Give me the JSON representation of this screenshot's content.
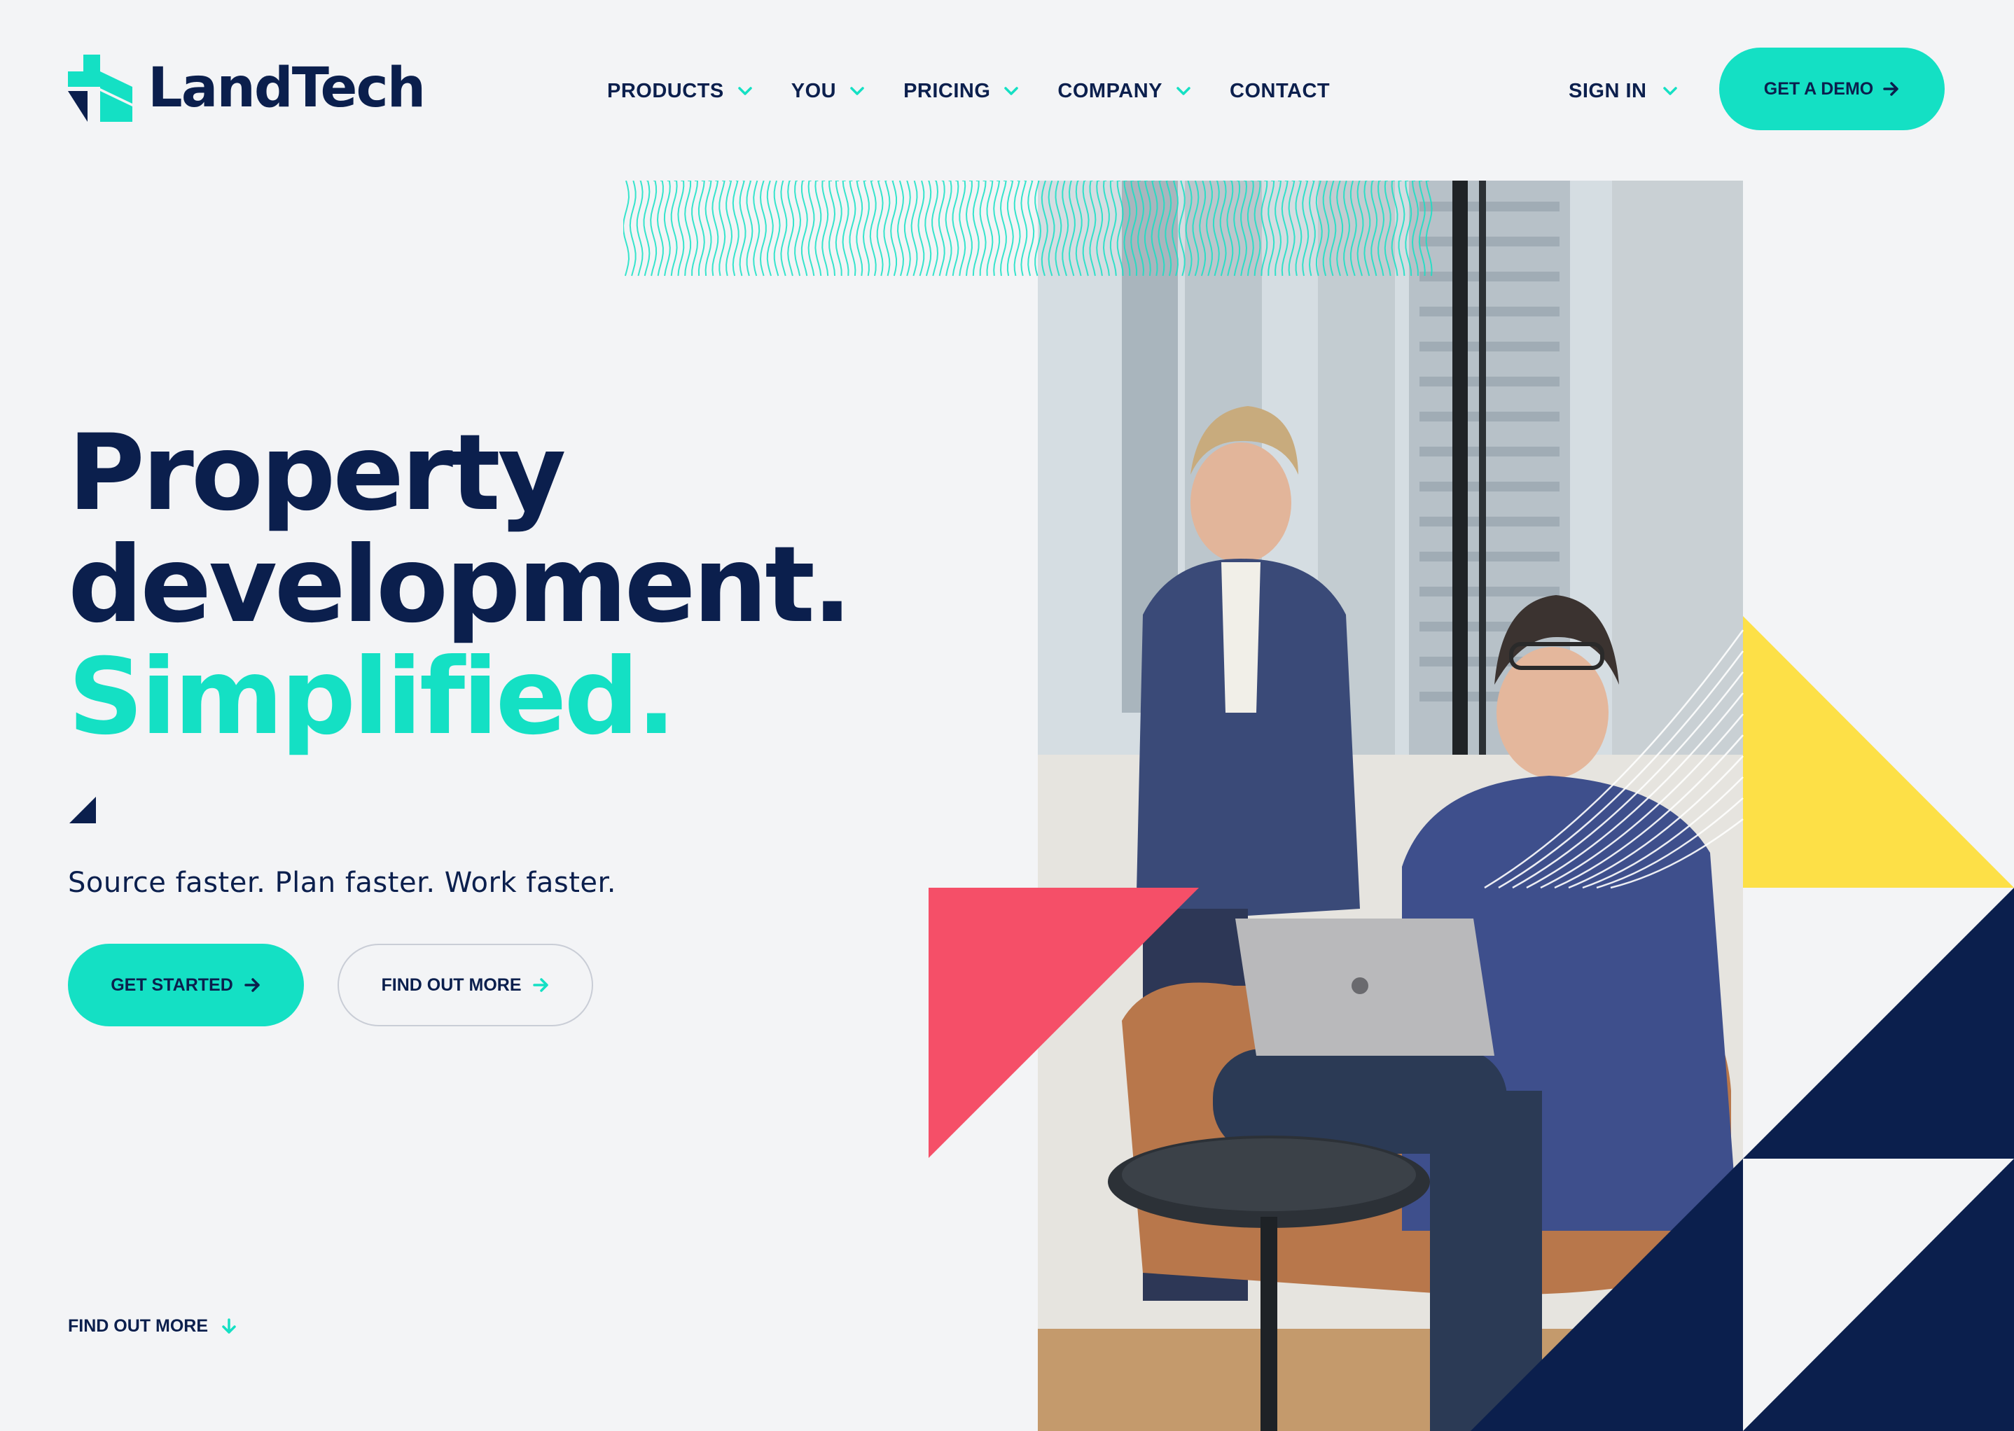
{
  "brand": {
    "name": "LandTech",
    "accent": "#14e0c4",
    "navy": "#0b1f4d",
    "coral": "#f54f68",
    "yellow": "#fde047"
  },
  "nav": {
    "items": [
      {
        "label": "PRODUCTS",
        "has_dropdown": true
      },
      {
        "label": "YOU",
        "has_dropdown": true
      },
      {
        "label": "PRICING",
        "has_dropdown": true
      },
      {
        "label": "COMPANY",
        "has_dropdown": true
      },
      {
        "label": "CONTACT",
        "has_dropdown": false
      }
    ],
    "sign_in": "SIGN IN",
    "demo_button": "GET A DEMO"
  },
  "hero": {
    "title_line1": "Property",
    "title_line2": "development.",
    "title_line3": "Simplified.",
    "tagline": "Source faster. Plan faster. Work faster.",
    "primary_button": "GET STARTED",
    "secondary_button": "FIND OUT MORE",
    "scroll_link": "FIND OUT MORE"
  },
  "icons": {
    "logo": "landtech-logo-icon",
    "dropdown": "chevron-down-icon",
    "button_arrow": "arrow-right-icon",
    "scroll_arrow": "arrow-down-icon"
  }
}
